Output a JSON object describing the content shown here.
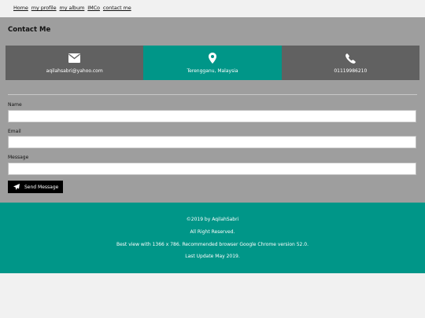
{
  "nav": {
    "links": [
      "Home",
      "my profile",
      "my album",
      "IMCo",
      "contact me"
    ]
  },
  "contact": {
    "title": "Contact Me",
    "cards": [
      {
        "icon": "envelope-icon",
        "text": "aqilahsabri@yahoo.com"
      },
      {
        "icon": "map-marker-icon",
        "text": "Terengganu, Malaysia"
      },
      {
        "icon": "phone-icon",
        "text": "01119986210"
      }
    ],
    "form": {
      "name_label": "Name",
      "email_label": "Email",
      "message_label": "Message",
      "name_value": "",
      "email_value": "",
      "message_value": "",
      "send_label": "Send Message"
    }
  },
  "footer": {
    "copyright": "©2019 by AqilahSabri",
    "rights": "All Right Reserved.",
    "best_view": "Best view with 1366 x 786. Recommended browser Google Chrome version 52.0.",
    "last_update": "Last Update May 2019."
  },
  "colors": {
    "teal": "#009688",
    "dark_gray": "#616161",
    "section_gray": "#9e9e9e",
    "button_black": "#000000"
  }
}
